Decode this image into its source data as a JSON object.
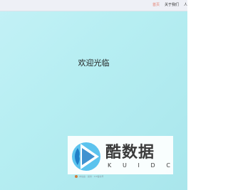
{
  "nav": {
    "items": [
      {
        "label": "首页",
        "active": true
      },
      {
        "label": "关于我们",
        "active": false
      },
      {
        "label": "人",
        "active": false
      }
    ]
  },
  "main": {
    "welcome_text": "欢迎光临"
  },
  "watermark": {
    "brand_name": "酷数据",
    "letters": [
      "K",
      "U",
      "I",
      "D",
      "C"
    ],
    "logo_icon": "play-triangle-icon",
    "colors": {
      "logo_dark": "#1f7fc8",
      "logo_light": "#5bc3ee",
      "text": "#3a3a3a"
    }
  },
  "footer": {
    "text": "本站由 · 提供 · ICP备案号"
  },
  "colors": {
    "background": "#b6eef2",
    "topbar": "#eef0f6",
    "active_nav": "#e67e6e"
  }
}
